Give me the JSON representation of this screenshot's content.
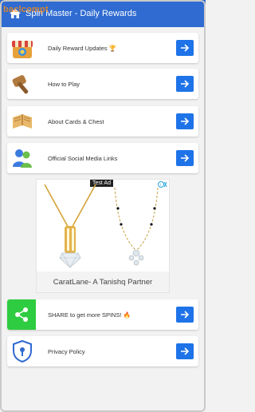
{
  "appbar": {
    "title": "Spin Master - Daily Rewards",
    "watermark": "baclcompt"
  },
  "menu": [
    {
      "label": "Daily Reward Updates 🏆",
      "icon": "shop-icon"
    },
    {
      "label": "How to Play",
      "icon": "hammer-icon"
    },
    {
      "label": "About Cards & Chest",
      "icon": "book-icon"
    },
    {
      "label": "Official Social Media Links",
      "icon": "users-icon"
    }
  ],
  "ad": {
    "tag": "Test Ad",
    "caption": "CaratLane- A Tanishq Partner"
  },
  "bottom_menu": [
    {
      "label": "SHARE to get more SPINS! 🔥",
      "icon": "share-icon"
    },
    {
      "label": "Privacy Policy",
      "icon": "privacy-shield-icon"
    }
  ],
  "colors": {
    "appbar": "#2f6bd1",
    "arrow_button": "#1e73e8",
    "share_green": "#2ecc40"
  }
}
